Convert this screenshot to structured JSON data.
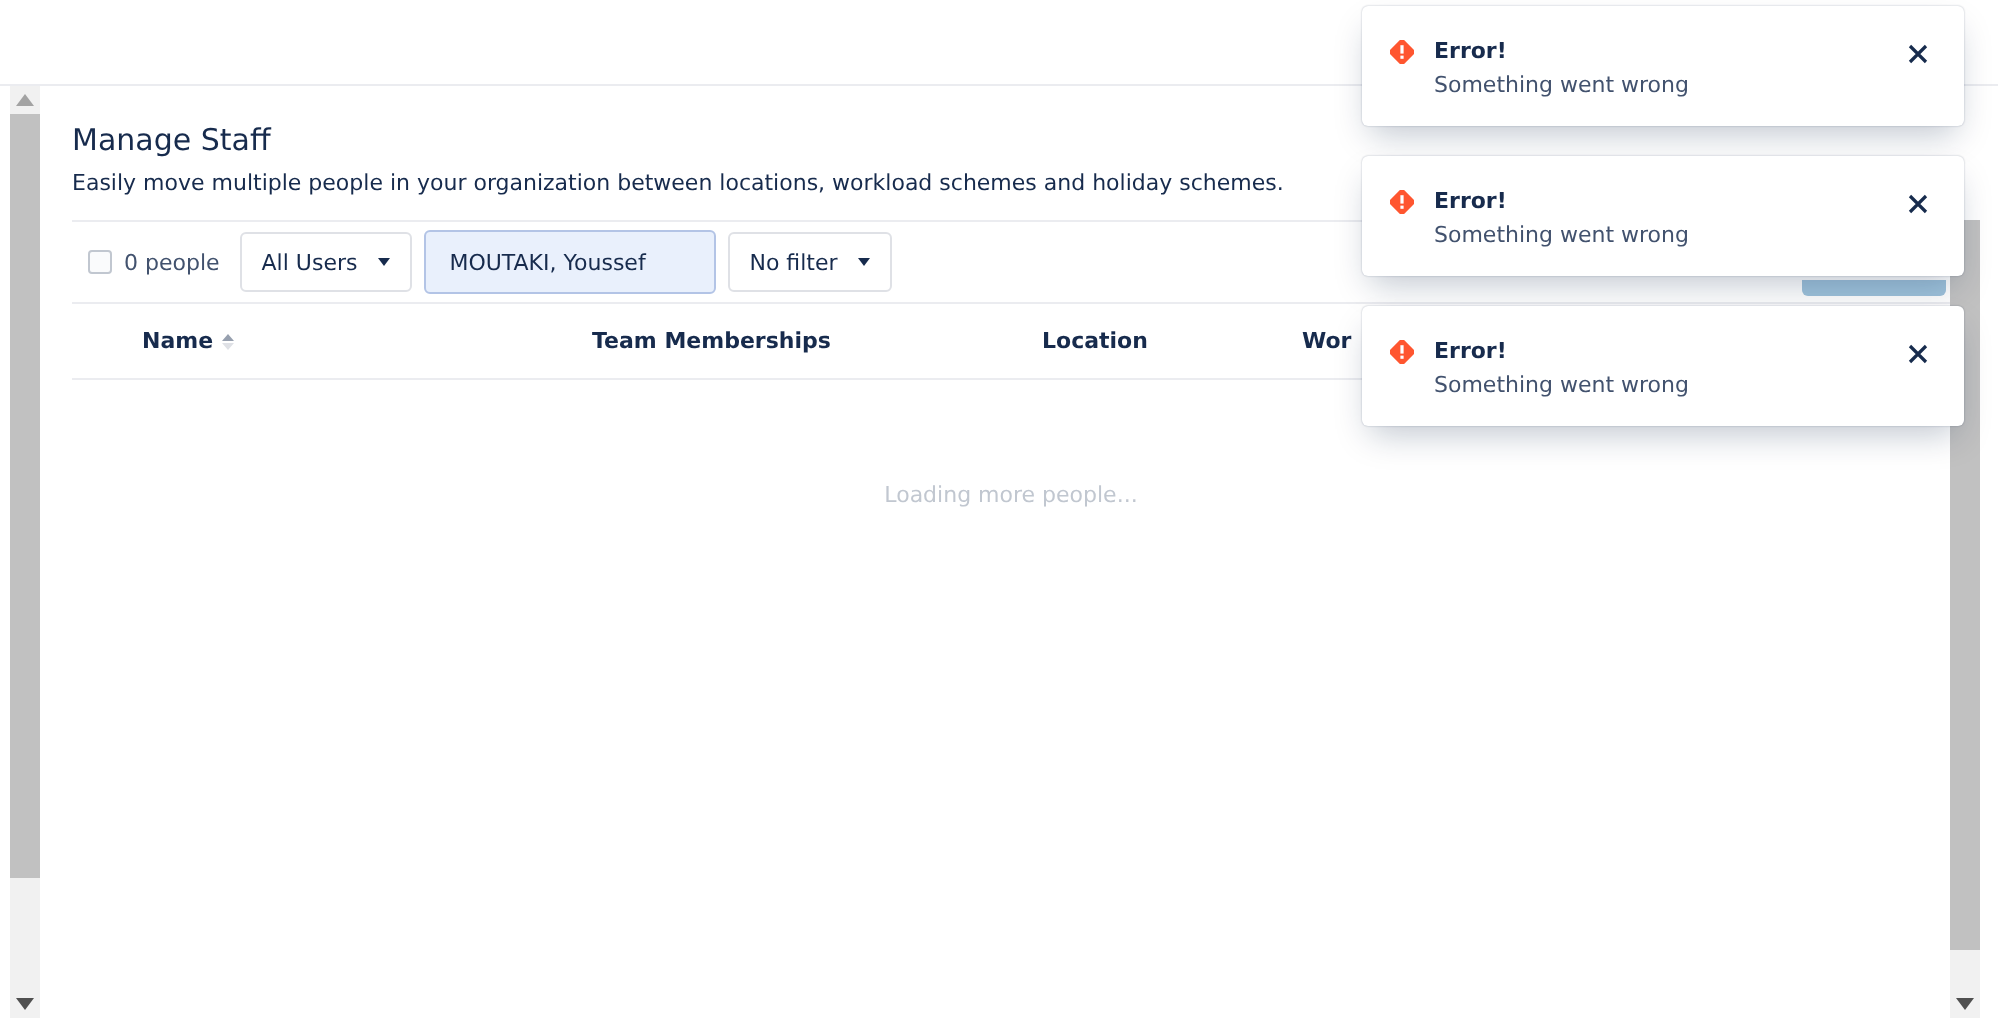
{
  "page": {
    "title": "Manage Staff",
    "description": "Easily move multiple people in your organization between locations, workload schemes and holiday schemes."
  },
  "toolbar": {
    "select_all": {
      "checked": false,
      "label": "0 people"
    },
    "user_filter": "All Users",
    "search_value": "MOUTAKI, Youssef",
    "filter": "No filter"
  },
  "table": {
    "columns": [
      {
        "label": "Name",
        "sortable": true
      },
      {
        "label": "Team Memberships",
        "sortable": false
      },
      {
        "label": "Location",
        "sortable": false
      },
      {
        "label": "Wor",
        "sortable": false
      }
    ],
    "loading_text": "Loading more people..."
  },
  "toasts": [
    {
      "title": "Error!",
      "message": "Something went wrong"
    },
    {
      "title": "Error!",
      "message": "Something went wrong"
    },
    {
      "title": "Error!",
      "message": "Something went wrong"
    }
  ]
}
